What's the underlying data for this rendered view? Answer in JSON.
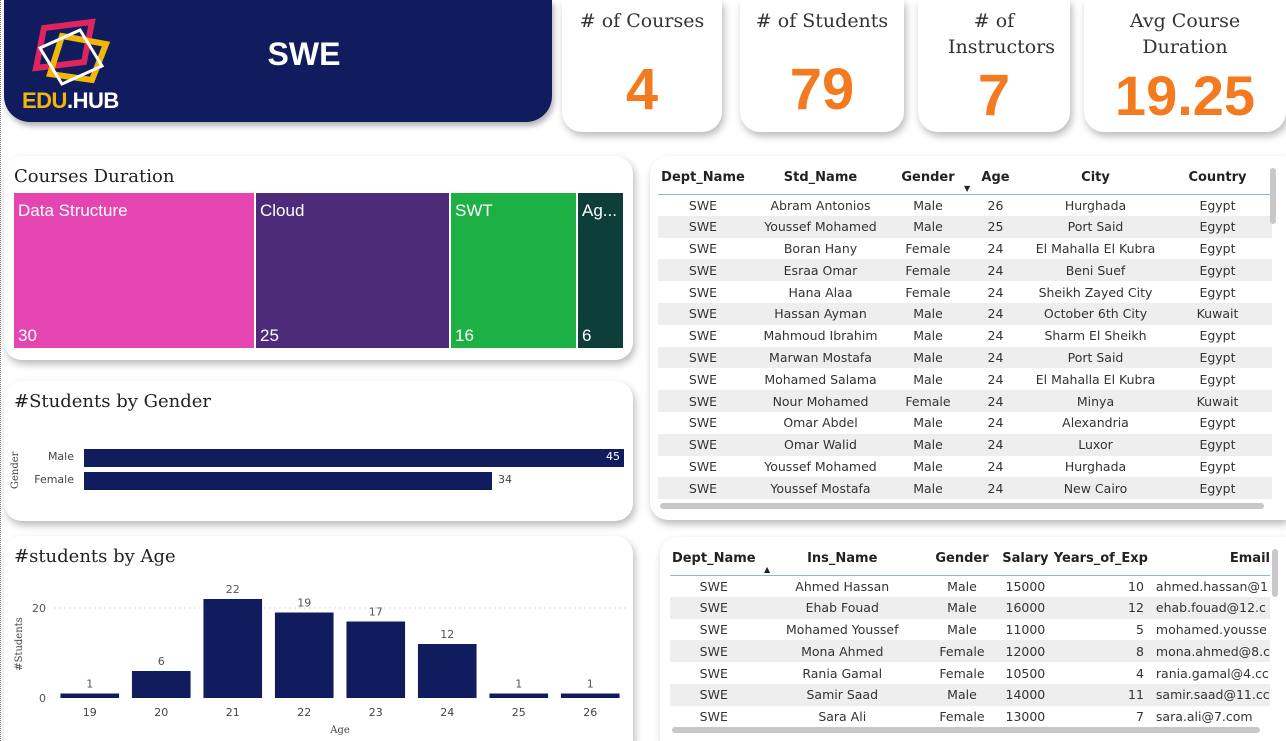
{
  "header": {
    "logo_text_a": "EDU",
    "logo_text_b": ".HUB",
    "title": "SWE"
  },
  "kpis": [
    {
      "label": "# of Courses",
      "value": "4"
    },
    {
      "label": "# of Students",
      "value": "79"
    },
    {
      "label": "# of Instructors",
      "value": "7"
    },
    {
      "label": "Avg Course Duration",
      "value": "19.25"
    }
  ],
  "courses_duration": {
    "title": "Courses Duration",
    "items": [
      {
        "name": "Data Structure",
        "value": "30",
        "color": "#e545b0"
      },
      {
        "name": "Cloud",
        "value": "25",
        "color": "#4e2b78"
      },
      {
        "name": "SWT",
        "value": "16",
        "color": "#1db044"
      },
      {
        "name": "Ag...",
        "value": "6",
        "color": "#0e3e3a"
      }
    ]
  },
  "gender_chart": {
    "title": "#Students by Gender",
    "axis_label": "Gender",
    "bars": [
      {
        "label": "Male",
        "value": 45,
        "value_text": "45"
      },
      {
        "label": "Female",
        "value": 34,
        "value_text": "34"
      }
    ],
    "max": 45
  },
  "chart_data": {
    "type": "bar",
    "title": "#students by Age",
    "xlabel": "Age",
    "ylabel": "#Students",
    "categories": [
      "19",
      "20",
      "21",
      "22",
      "23",
      "24",
      "25",
      "26"
    ],
    "values": [
      1,
      6,
      22,
      19,
      17,
      12,
      1,
      1
    ],
    "ylim": [
      0,
      24
    ],
    "yticks": [
      "0",
      "20"
    ],
    "color": "#111c5e"
  },
  "students_table": {
    "columns": [
      "Dept_Name",
      "Std_Name",
      "Gender",
      "Age",
      "City",
      "Country"
    ],
    "rows": [
      [
        "SWE",
        "Abram Antonios",
        "Male",
        "26",
        "Hurghada",
        "Egypt"
      ],
      [
        "SWE",
        "Youssef Mohamed",
        "Male",
        "25",
        "Port Said",
        "Egypt"
      ],
      [
        "SWE",
        "Boran Hany",
        "Female",
        "24",
        "El Mahalla El Kubra",
        "Egypt"
      ],
      [
        "SWE",
        "Esraa Omar",
        "Female",
        "24",
        "Beni Suef",
        "Egypt"
      ],
      [
        "SWE",
        "Hana Alaa",
        "Female",
        "24",
        "Sheikh Zayed City",
        "Egypt"
      ],
      [
        "SWE",
        "Hassan Ayman",
        "Male",
        "24",
        "October 6th City",
        "Kuwait"
      ],
      [
        "SWE",
        "Mahmoud Ibrahim",
        "Male",
        "24",
        "Sharm El Sheikh",
        "Egypt"
      ],
      [
        "SWE",
        "Marwan Mostafa",
        "Male",
        "24",
        "Port Said",
        "Egypt"
      ],
      [
        "SWE",
        "Mohamed Salama",
        "Male",
        "24",
        "El Mahalla El Kubra",
        "Egypt"
      ],
      [
        "SWE",
        "Nour Mohamed",
        "Female",
        "24",
        "Minya",
        "Kuwait"
      ],
      [
        "SWE",
        "Omar Abdel",
        "Male",
        "24",
        "Alexandria",
        "Egypt"
      ],
      [
        "SWE",
        "Omar Walid",
        "Male",
        "24",
        "Luxor",
        "Egypt"
      ],
      [
        "SWE",
        "Youssef Mohamed",
        "Male",
        "24",
        "Hurghada",
        "Egypt"
      ],
      [
        "SWE",
        "Youssef Mostafa",
        "Male",
        "24",
        "New Cairo",
        "Egypt"
      ]
    ]
  },
  "instructors_table": {
    "columns": [
      "Dept_Name",
      "Ins_Name",
      "Gender",
      "Salary",
      "Years_of_Exp",
      "Email"
    ],
    "rows": [
      [
        "SWE",
        "Ahmed Hassan",
        "Male",
        "15000",
        "10",
        "ahmed.hassan@1"
      ],
      [
        "SWE",
        "Ehab Fouad",
        "Male",
        "16000",
        "12",
        "ehab.fouad@12.c"
      ],
      [
        "SWE",
        "Mohamed Youssef",
        "Male",
        "11000",
        "5",
        "mohamed.yousse"
      ],
      [
        "SWE",
        "Mona Ahmed",
        "Female",
        "12000",
        "8",
        "mona.ahmed@8.c"
      ],
      [
        "SWE",
        "Rania Gamal",
        "Female",
        "10500",
        "4",
        "rania.gamal@4.cc"
      ],
      [
        "SWE",
        "Samir Saad",
        "Male",
        "14000",
        "11",
        "samir.saad@11.cc"
      ],
      [
        "SWE",
        "Sara Ali",
        "Female",
        "13000",
        "7",
        "sara.ali@7.com"
      ]
    ]
  }
}
